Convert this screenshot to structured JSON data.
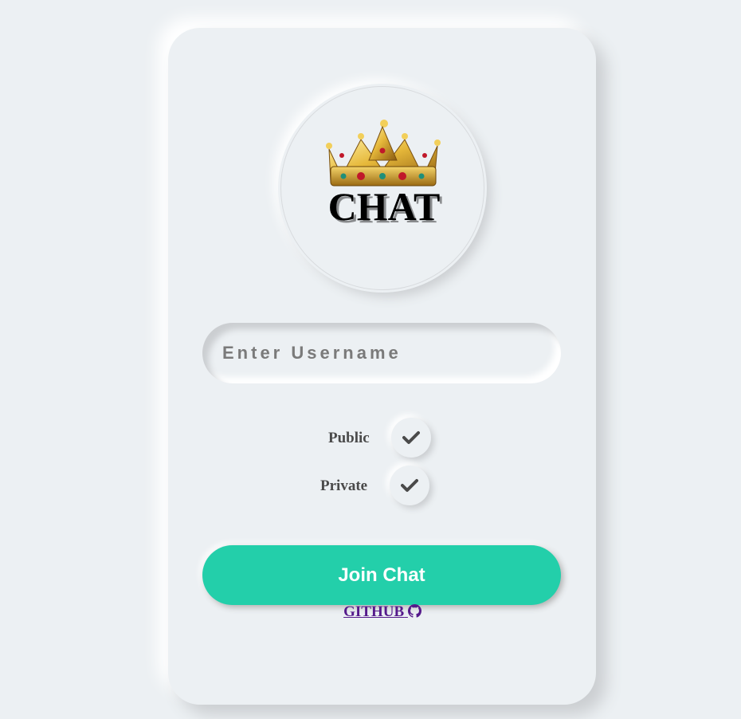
{
  "logo": {
    "text": "CHAT",
    "icon": "crown-icon"
  },
  "username": {
    "placeholder": "Enter Username",
    "value": ""
  },
  "options": {
    "public_label": "Public",
    "private_label": "Private",
    "check_icon": "checkmark-icon"
  },
  "actions": {
    "join_label": "Join Chat",
    "github_label": "GITHUB",
    "github_icon": "github-icon"
  },
  "colors": {
    "background": "#ecf0f3",
    "accent": "#23cfaa",
    "link": "#551a8b",
    "text": "#4a4a4a"
  }
}
